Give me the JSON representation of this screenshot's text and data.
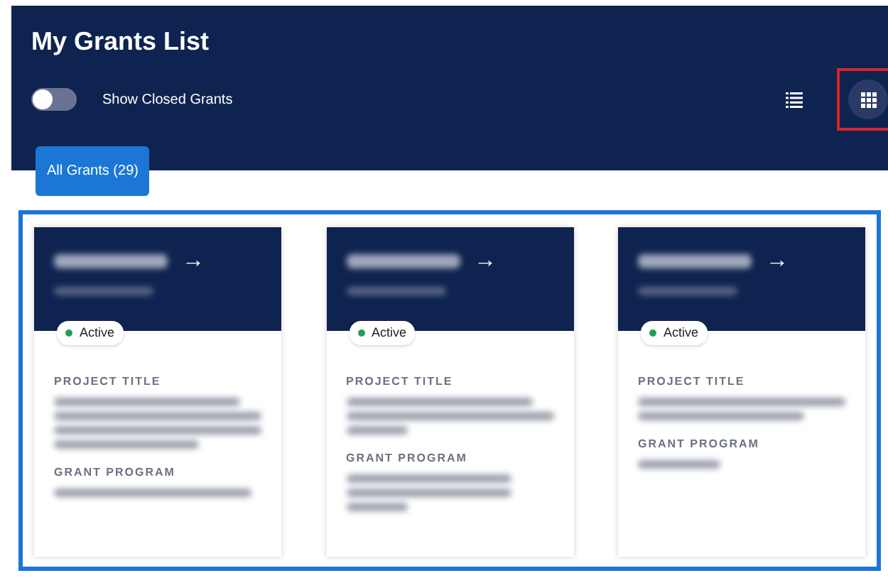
{
  "header": {
    "title": "My Grants List"
  },
  "toggle": {
    "label": "Show Closed Grants",
    "on": false
  },
  "views": [
    {
      "kind": "list",
      "selected": false
    },
    {
      "kind": "grid",
      "selected": true
    }
  ],
  "tabs": [
    {
      "label": "All Grants (29)",
      "selected": true
    }
  ],
  "cards": [
    {
      "arrow": "→",
      "status": "Active",
      "color": "#22a05a",
      "labels": [
        "PROJECT TITLE",
        "GRANT PROGRAM"
      ]
    },
    {
      "arrow": "→",
      "status": "Active",
      "color": "#22a05a",
      "labels": [
        "PROJECT TITLE",
        "GRANT PROGRAM"
      ]
    },
    {
      "arrow": "→",
      "status": "Active",
      "color": "#22a05a",
      "labels": [
        "PROJECT TITLE",
        "GRANT PROGRAM"
      ]
    }
  ]
}
